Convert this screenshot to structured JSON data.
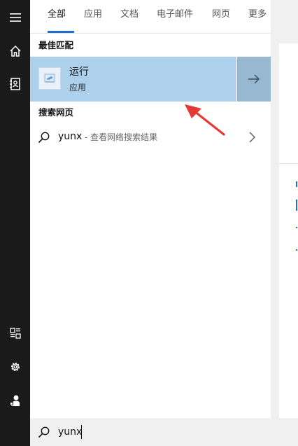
{
  "tabs": [
    {
      "label": "全部",
      "active": true
    },
    {
      "label": "应用",
      "active": false
    },
    {
      "label": "文档",
      "active": false
    },
    {
      "label": "电子邮件",
      "active": false
    },
    {
      "label": "网页",
      "active": false
    },
    {
      "label": "更多",
      "active": false
    }
  ],
  "best_match": {
    "section_label": "最佳匹配",
    "title": "运行",
    "subtitle": "应用"
  },
  "web": {
    "section_label": "搜索网页",
    "query": "yunx",
    "description": "- 查看网络搜索结果"
  },
  "search": {
    "value": "yunx"
  },
  "rail": {
    "icons": [
      "hamburger-icon",
      "home-icon",
      "notebook-icon",
      "document-icon",
      "gear-icon",
      "user-icon"
    ]
  },
  "colors": {
    "accent": "#1f6fd1",
    "selected_row": "#add1ec",
    "arrow_button": "#98b8d1",
    "rail": "#1a1a1a",
    "annotation": "#e53935"
  }
}
